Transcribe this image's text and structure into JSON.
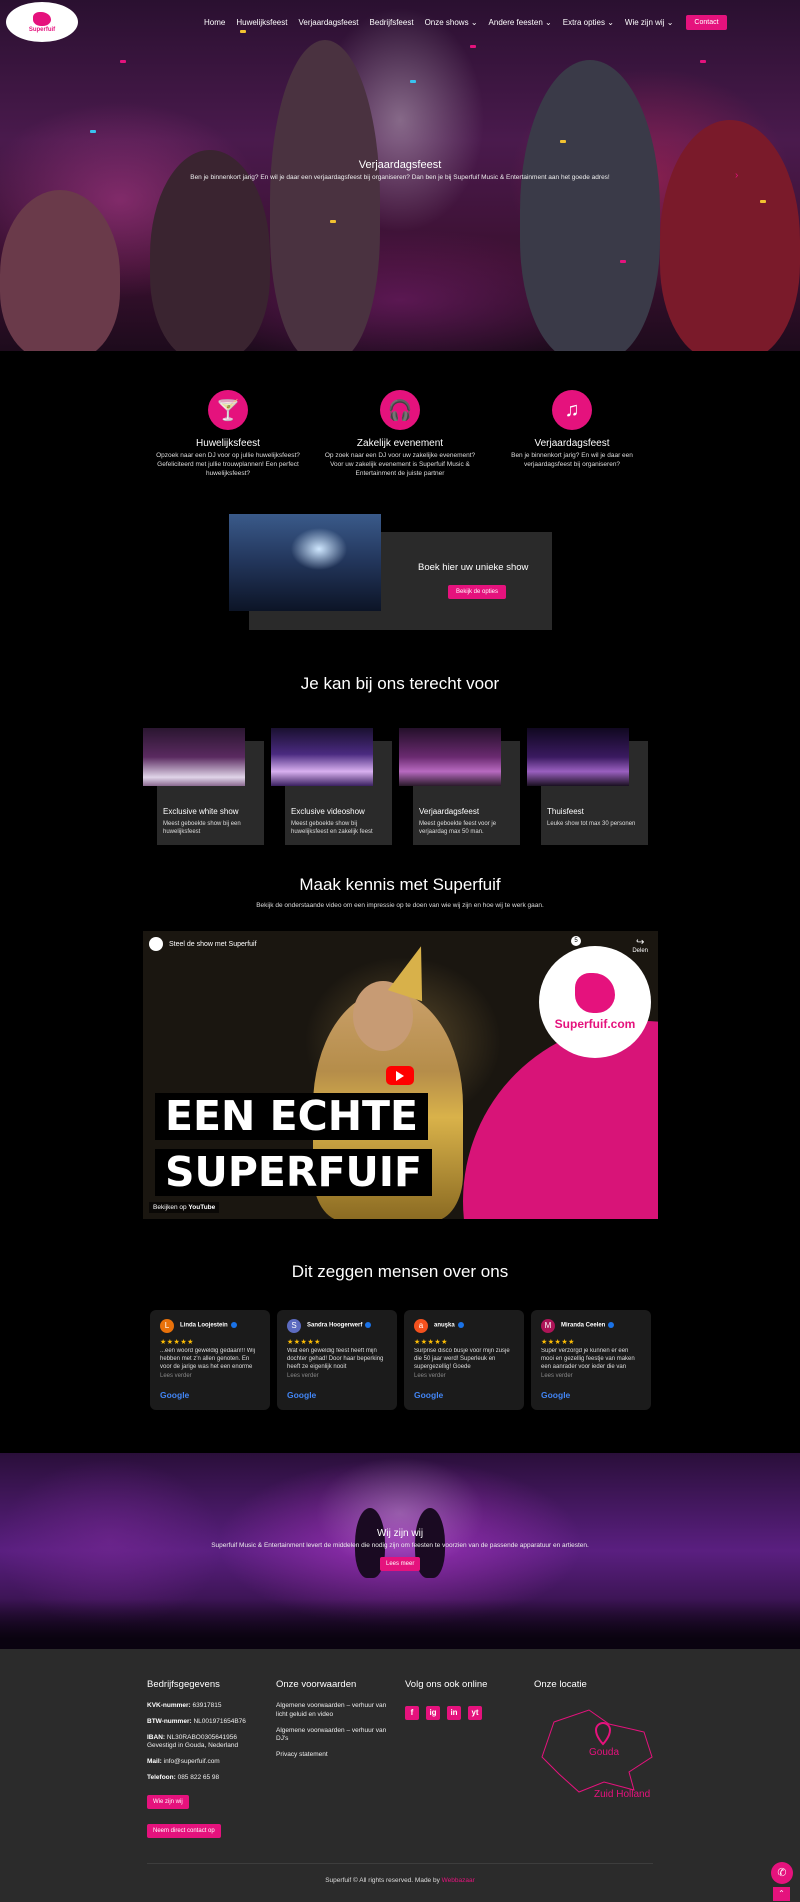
{
  "logo": {
    "text": "Superfuif",
    "sub": "Music & Entertainment"
  },
  "nav": {
    "items": [
      "Home",
      "Huwelijksfeest",
      "Verjaardagsfeest",
      "Bedrijfsfeest",
      "Onze shows",
      "Andere feesten",
      "Extra opties",
      "Wie zijn wij"
    ],
    "contact": "Contact"
  },
  "hero": {
    "title": "Verjaardagsfeest",
    "subtitle": "Ben je binnenkort jarig? En wil je daar een verjaardagsfeest bij organiseren? Dan ben je bij Superfuif Music & Entertainment aan het goede adres!"
  },
  "features": [
    {
      "title": "Huwelijksfeest",
      "text": "Opzoek naar een DJ voor op jullie huwelijksfeest? Gefeliciteerd met jullie trouwplannen! Een perfect huwelijksfeest?",
      "icon": "cocktail-icon"
    },
    {
      "title": "Zakelijk evenement",
      "text": "Op zoek naar een DJ voor uw zakelijke evenement? Voor uw zakelijk evenement is Superfuif Music & Entertainment de juiste partner",
      "icon": "headphones-icon"
    },
    {
      "title": "Verjaardagsfeest",
      "text": "Ben je binnenkort jarig? En wil je daar een verjaardagsfeest bij organiseren?",
      "icon": "music-note-icon"
    }
  ],
  "book": {
    "title": "Boek hier uw unieke show",
    "button": "Bekijk de opties"
  },
  "services": {
    "title": "Je kan bij ons terecht voor",
    "cards": [
      {
        "title": "Exclusive white show",
        "text": "Meest geboekte show bij een huwelijksfeest"
      },
      {
        "title": "Exclusive videoshow",
        "text": "Meest geboekte show bij huwelijksfeest en zakelijk feest"
      },
      {
        "title": "Verjaardagsfeest",
        "text": "Meest geboekte feest voor je verjaardag max 50 man."
      },
      {
        "title": "Thuisfeest",
        "text": "Leuke show tot max 30 personen"
      }
    ]
  },
  "intro": {
    "title": "Maak kennis met Superfuif",
    "subtitle": "Bekijk de onderstaande video om een impressie op te doen van wie wij zijn en hoe wij te werk gaan."
  },
  "video": {
    "channel_title": "Steel de show met Superfuif",
    "share": "Delen",
    "line1": "EEN ECHTE",
    "line2": "SUPERFUIF",
    "logo_text": "Superfuif.com",
    "watch_on": "Bekijken op",
    "youtube": "YouTube",
    "watch_later": "5"
  },
  "reviews": {
    "title": "Dit zeggen mensen over ons",
    "items": [
      {
        "name": "Linda Loojestein",
        "initial": "L",
        "color": "#e8710a",
        "text": "...een woord geweldig gedaan!!! Wij hebben met z'n allen genoten. En voor de jarige was het een enorme",
        "more": "Lees verder"
      },
      {
        "name": "Sandra Hoogerwerf",
        "initial": "S",
        "color": "#5c6bc0",
        "text": "Wat een geweldig feest heeft mijn dochter gehad! Door haar beperking heeft ze eigenlijk nooit",
        "more": "Lees verder"
      },
      {
        "name": "anuşka",
        "initial": "a",
        "color": "#f4511e",
        "text": "Surprise disco busje voor mijn zusje die 50 jaar werd! Superleuk en supergezellig! Goede",
        "more": "Lees verder"
      },
      {
        "name": "Miranda Ceelen",
        "initial": "M",
        "color": "#ad1457",
        "text": "Super verzorgd je kunnen er een mooi en gezellig feestje van maken een aanrader voor ieder die van",
        "more": "Lees verder"
      }
    ],
    "stars": "★★★★★",
    "google": "Google"
  },
  "about": {
    "title": "Wij zijn wij",
    "text": "Superfuif Music & Entertainment levert de middelen die nodig zijn om feesten te voorzien van de passende apparatuur en artiesten.",
    "button": "Lees meer"
  },
  "footer": {
    "company": {
      "title": "Bedrijfsgegevens",
      "kvk_label": "KVK-nummer:",
      "kvk": "63917815",
      "btw_label": "BTW-nummer:",
      "btw": "NL001971654B76",
      "iban_label": "IBAN:",
      "iban": "NL30RABO0305641956",
      "location": "Gevestigd in Gouda, Nederland",
      "mail_label": "Mail:",
      "mail": "info@superfuif.com",
      "phone_label": "Telefoon:",
      "phone": "085 822 65 98",
      "btn1": "Wie zijn wij",
      "btn2": "Neem direct contact op"
    },
    "terms": {
      "title": "Onze voorwaarden",
      "links": [
        "Algemene voorwaarden – verhuur van licht geluid en video",
        "Algemene voorwaarden – verhuur van DJ's",
        "Privacy statement"
      ]
    },
    "social": {
      "title": "Volg ons ook online",
      "items": [
        "f",
        "ig",
        "in",
        "yt"
      ]
    },
    "location": {
      "title": "Onze locatie",
      "city": "Gouda",
      "region": "Zuid Holland"
    },
    "copyright": "Superfuif © All rights reserved. Made by",
    "maker": "Webbazaar"
  },
  "colors": {
    "accent": "#e5127d",
    "footer_bg": "#2b2b2b",
    "card_bg": "#2a2a2a"
  }
}
